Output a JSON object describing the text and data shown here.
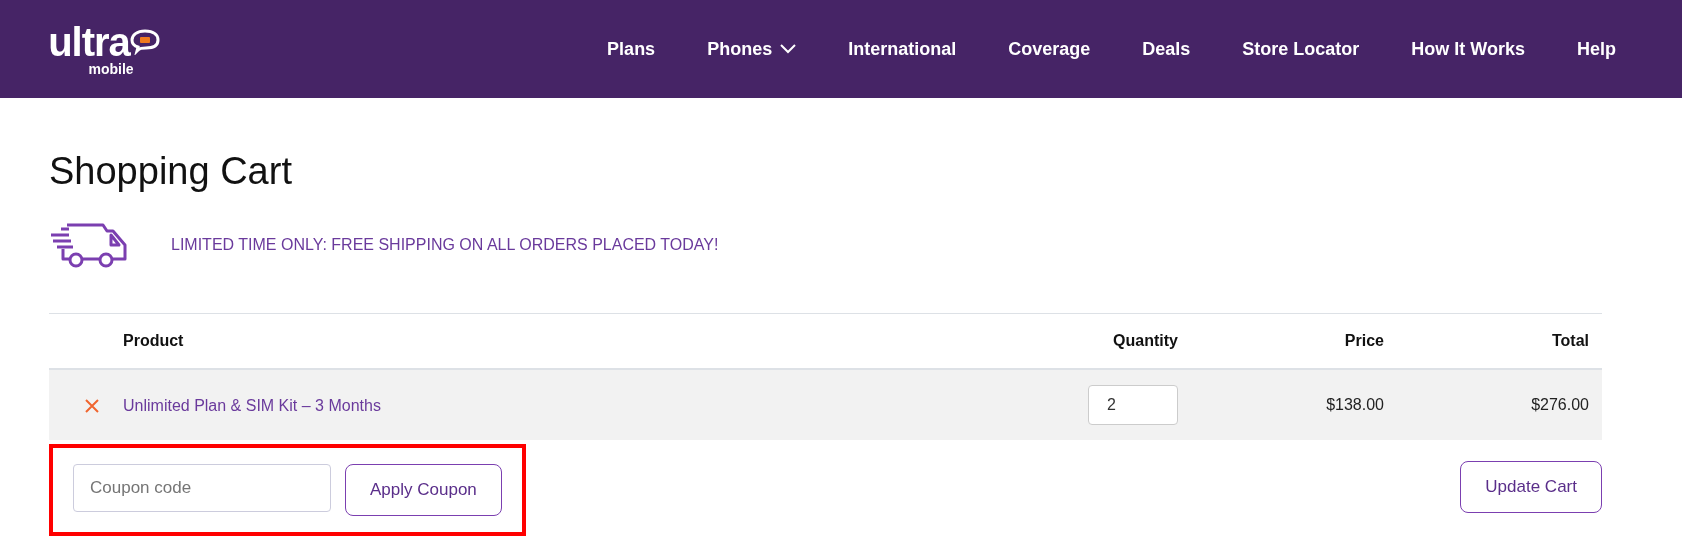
{
  "logo": {
    "wordmark": "ultra",
    "subword": "mobile"
  },
  "nav": [
    {
      "label": "Plans",
      "has_menu": false
    },
    {
      "label": "Phones",
      "has_menu": true
    },
    {
      "label": "International",
      "has_menu": false
    },
    {
      "label": "Coverage",
      "has_menu": false
    },
    {
      "label": "Deals",
      "has_menu": false
    },
    {
      "label": "Store Locator",
      "has_menu": false
    },
    {
      "label": "How It Works",
      "has_menu": false
    },
    {
      "label": "Help",
      "has_menu": false
    }
  ],
  "title": "Shopping Cart",
  "promo": "LIMITED TIME ONLY: FREE SHIPPING ON ALL ORDERS PLACED TODAY!",
  "table": {
    "columns": [
      "Product",
      "Quantity",
      "Price",
      "Total"
    ],
    "rows": [
      {
        "product": "Unlimited Plan & SIM Kit – 3 Months",
        "quantity": "2",
        "price": "$138.00",
        "total": "$276.00"
      }
    ]
  },
  "coupon": {
    "placeholder": "Coupon code",
    "apply_label": "Apply Coupon",
    "highlighted": true
  },
  "update_label": "Update Cart"
}
